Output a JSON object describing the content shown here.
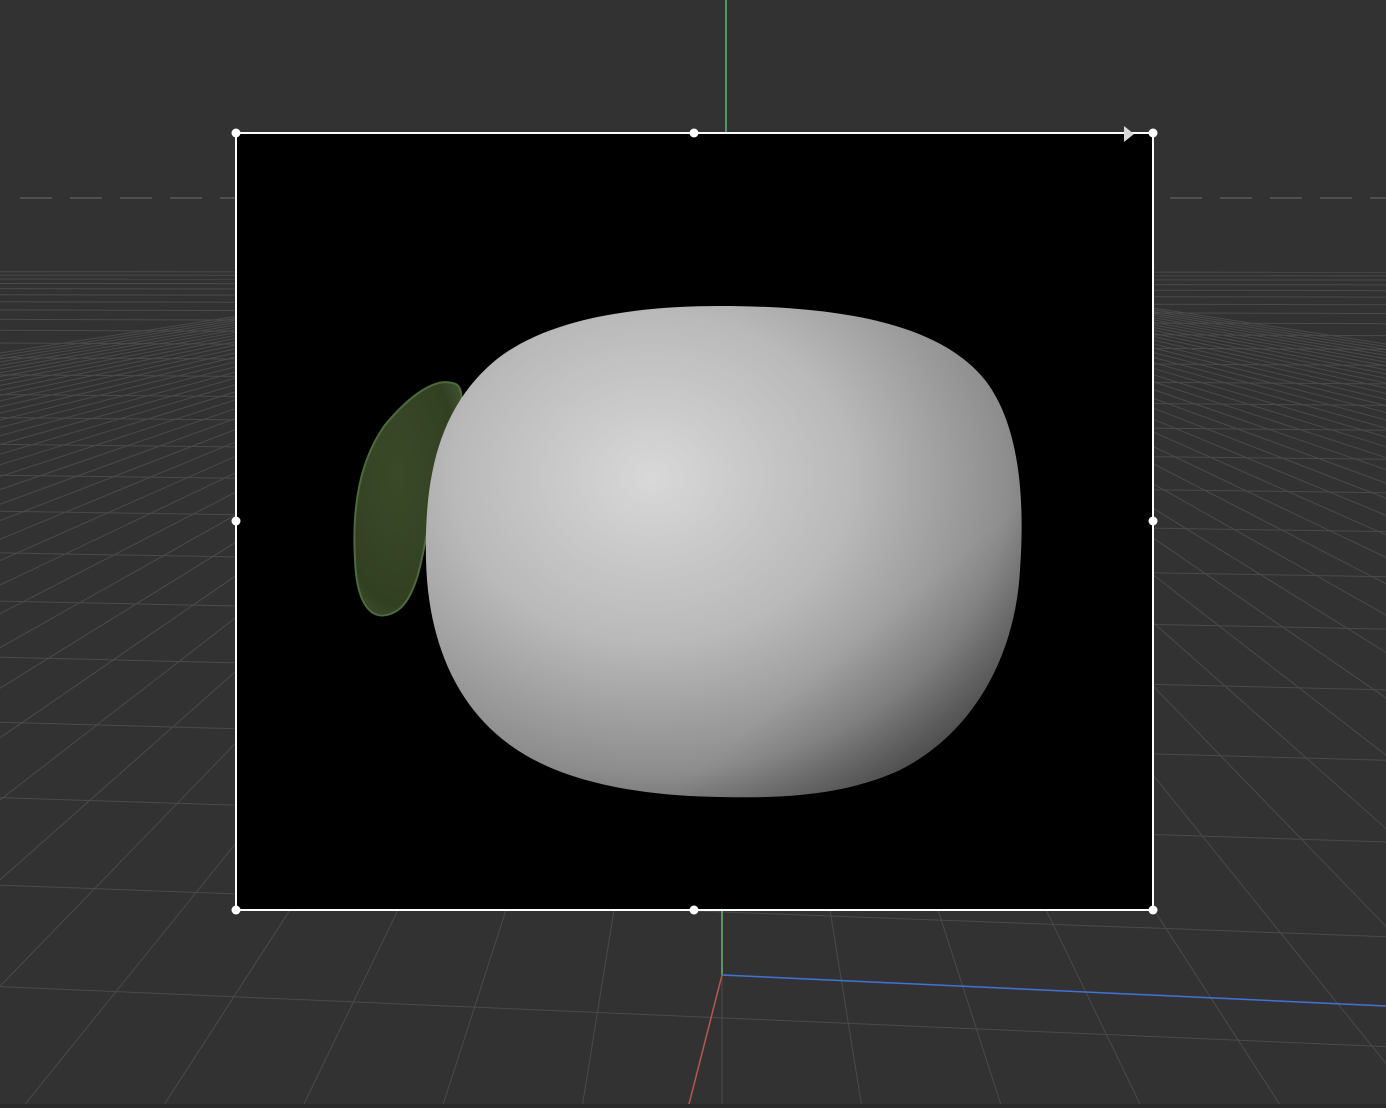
{
  "app": {
    "view": "3D viewport"
  },
  "viewport": {
    "background_color": "#323232",
    "grid_color": "#4a4a4a",
    "axis_colors": {
      "x": "#b8584c",
      "y": "#5fb87a",
      "z": "#3f74d4"
    }
  },
  "render_region": {
    "background_color": "#000000",
    "border_color": "#ffffff",
    "handles": [
      "top-left",
      "top-center",
      "top-right",
      "middle-left",
      "middle-right",
      "bottom-left",
      "bottom-center",
      "bottom-right"
    ]
  },
  "scene": {
    "objects": [
      {
        "name": "body",
        "color": "#c9c9c9",
        "shape": "rounded-blob"
      },
      {
        "name": "leaf",
        "color": "#3b4a2a",
        "shape": "leaf"
      }
    ]
  },
  "icons": {
    "corner_arrow": "play-triangle-icon",
    "handle": "circle-handle-icon"
  }
}
